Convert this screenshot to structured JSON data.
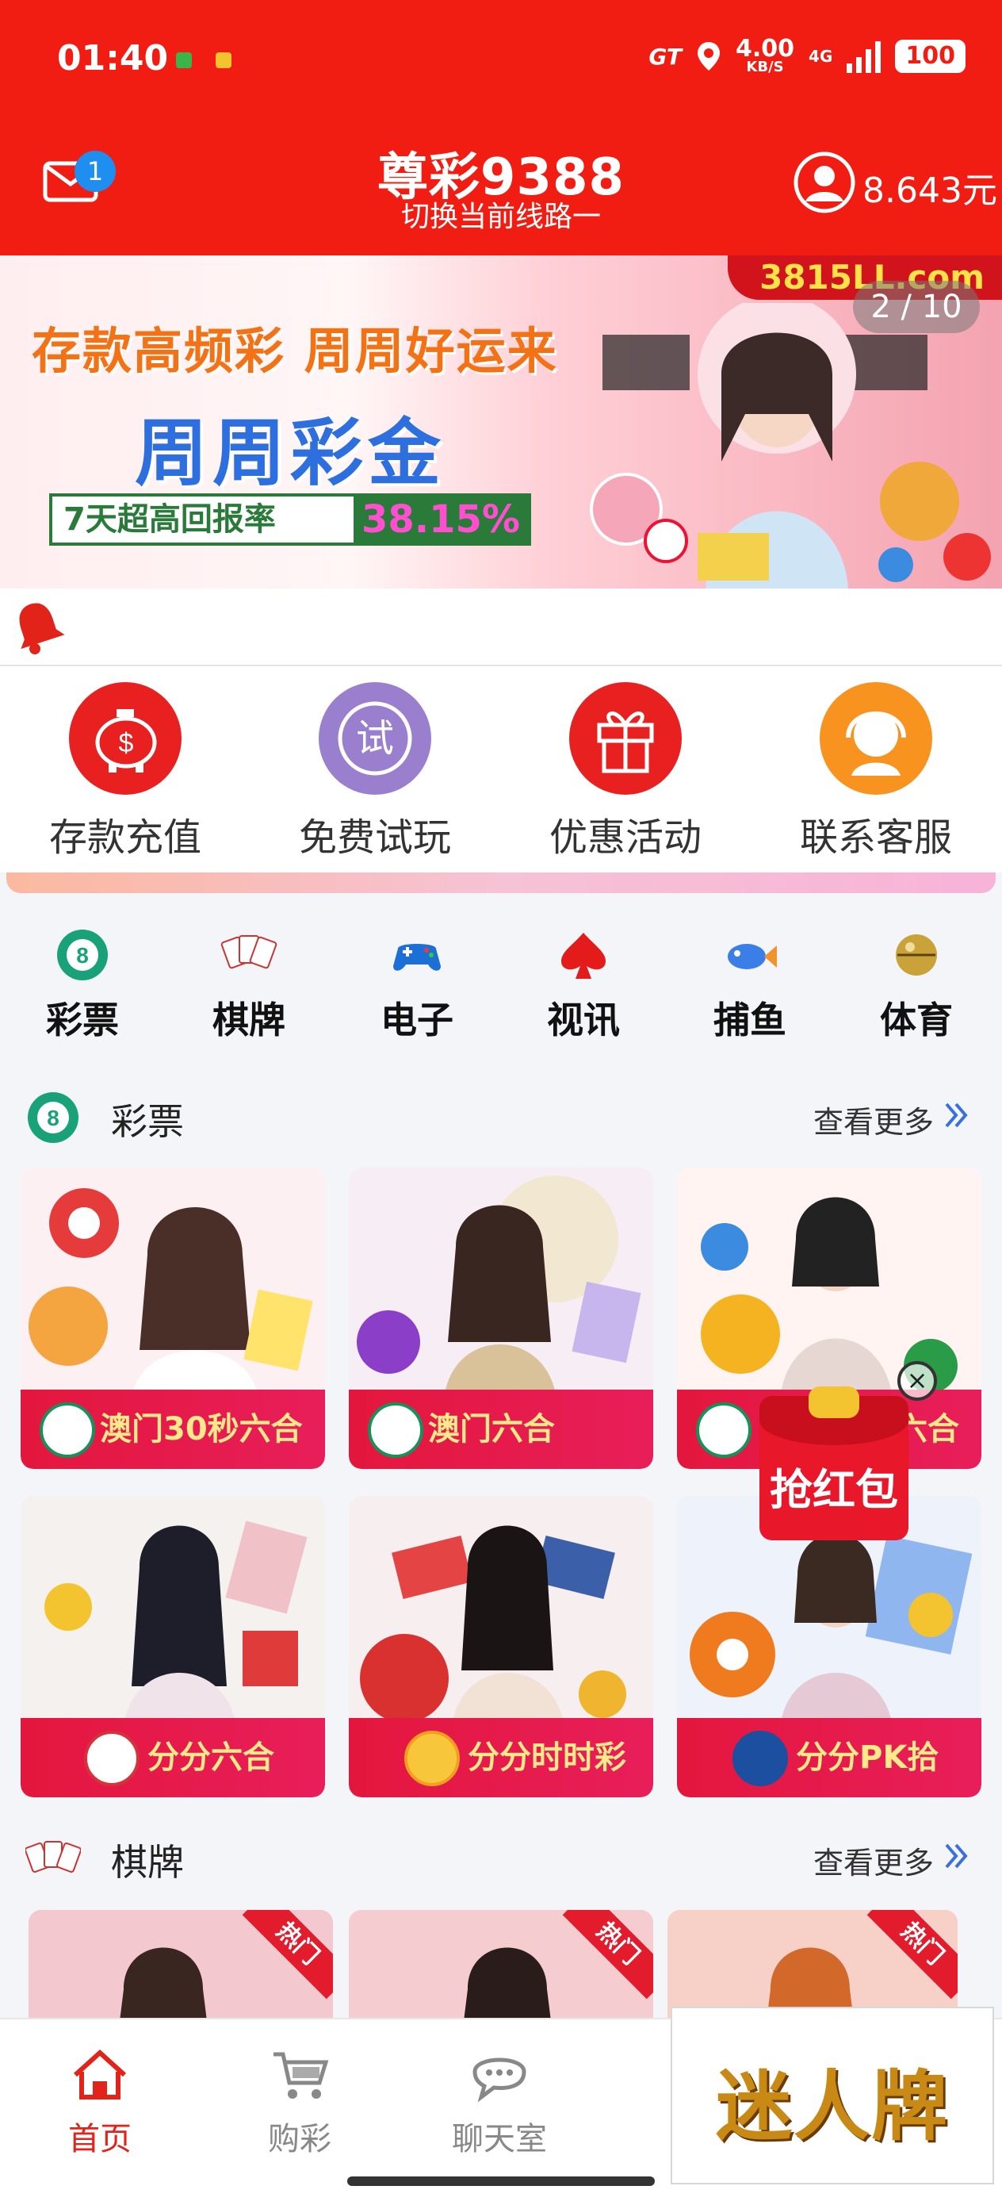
{
  "status_bar": {
    "time": "01:40",
    "carrier_tag": "GT",
    "net_speed_value": "4.00",
    "net_speed_unit": "KB/S",
    "network_type": "4G",
    "battery": "100"
  },
  "header": {
    "mail_badge": "1",
    "title": "尊彩9388",
    "subtitle": "切换当前线路一",
    "balance": "8.643元"
  },
  "banner": {
    "url_text": "3815LL.com",
    "counter": "2 / 10",
    "line1": "存款高频彩 周周好运来",
    "line2": "周周彩金",
    "box_label": "7天超高回报率",
    "box_value": "38.15%"
  },
  "quick_actions": [
    {
      "label": "存款充值",
      "icon": "piggy-bank-icon",
      "color": "#e8201f"
    },
    {
      "label": "免费试玩",
      "icon": "trial-icon",
      "icon_text": "试",
      "color": "#9b7fcf"
    },
    {
      "label": "优惠活动",
      "icon": "gift-icon",
      "color": "#e8201f"
    },
    {
      "label": "联系客服",
      "icon": "customer-service-icon",
      "color": "#f7931e"
    }
  ],
  "categories": [
    {
      "label": "彩票",
      "icon": "lottery-ball-icon"
    },
    {
      "label": "棋牌",
      "icon": "cards-icon"
    },
    {
      "label": "电子",
      "icon": "gamepad-icon"
    },
    {
      "label": "视讯",
      "icon": "spade-icon"
    },
    {
      "label": "捕鱼",
      "icon": "fish-icon"
    },
    {
      "label": "体育",
      "icon": "ball-icon"
    }
  ],
  "sections": {
    "lottery": {
      "title": "彩票",
      "more": "查看更多"
    },
    "chess": {
      "title": "棋牌",
      "more": "查看更多"
    }
  },
  "lottery_games": [
    {
      "name": "澳门30秒六合"
    },
    {
      "name": "澳门六合"
    },
    {
      "name": "六合"
    },
    {
      "name": "分分六合"
    },
    {
      "name": "分分时时彩"
    },
    {
      "name": "分分PK拾"
    }
  ],
  "chess_games": [
    {
      "badge": "热门"
    },
    {
      "badge": "热门"
    },
    {
      "badge": "热门"
    }
  ],
  "red_packet": {
    "label": "抢红包",
    "close": "×"
  },
  "bottom_nav": [
    {
      "label": "首页",
      "icon": "home-icon",
      "active": true
    },
    {
      "label": "购彩",
      "icon": "cart-icon",
      "active": false
    },
    {
      "label": "聊天室",
      "icon": "chat-icon",
      "active": false
    }
  ],
  "promo": {
    "text": "迷人牌"
  },
  "colors": {
    "brand_red": "#f21d12",
    "card_bar": "#e3173d",
    "accent_blue": "#2e6fe0"
  }
}
